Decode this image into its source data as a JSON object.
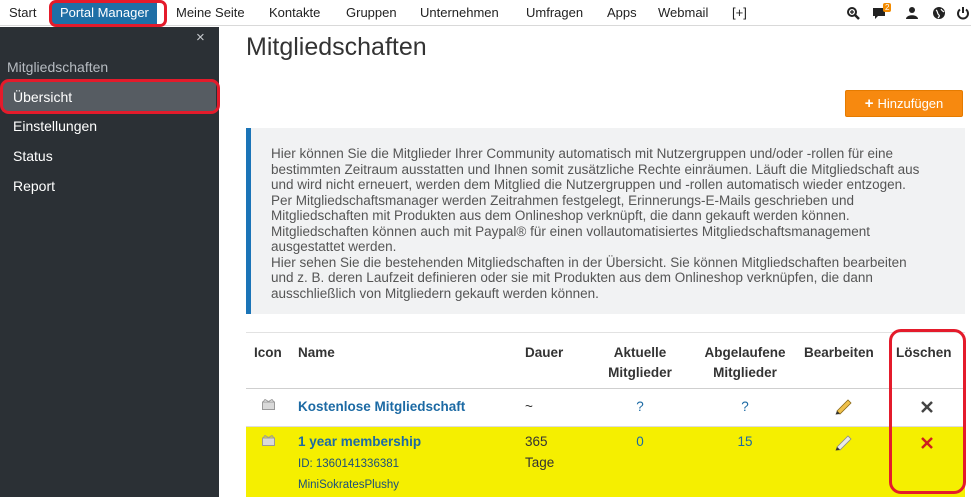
{
  "topnav": {
    "items": [
      "Start",
      "Portal Manager",
      "Meine Seite",
      "Kontakte",
      "Gruppen",
      "Unternehmen",
      "Umfragen",
      "Apps",
      "Webmail",
      "[+]"
    ],
    "active": "Portal Manager",
    "notification_count": "2",
    "icons": [
      "search-icon",
      "chat-icon",
      "user-icon",
      "globe-icon",
      "power-icon"
    ]
  },
  "sidebar": {
    "close": "×",
    "heading": "Mitgliedschaften",
    "items": [
      "Übersicht",
      "Einstellungen",
      "Status",
      "Report"
    ],
    "selected": "Übersicht"
  },
  "main": {
    "title": "Mitgliedschaften",
    "add_button": "Hinzufügen",
    "info_lines": [
      "Hier können Sie die Mitglieder Ihrer Community automatisch mit Nutzergruppen und/oder -rollen für eine",
      "bestimmten Zeitraum ausstatten und Ihnen somit zusätzliche Rechte einräumen. Läuft die Mitgliedschaft aus",
      "und wird nicht erneuert, werden dem Mitglied die Nutzergruppen und -rollen automatisch wieder entzogen.",
      "Per Mitgliedschaftsmanager werden Zeitrahmen festgelegt, Erinnerungs-E-Mails geschrieben und",
      "Mitgliedschaften mit Produkten aus dem Onlineshop verknüpft, die dann gekauft werden können.",
      "Mitgliedschaften können auch mit Paypal® für einen vollautomatisiertes Mitgliedschaftsmanagement",
      "ausgestattet werden.",
      "Hier sehen Sie die bestehenden Mitgliedschaften in der Übersicht. Sie können Mitgliedschaften bearbeiten",
      "und z. B. deren Laufzeit definieren oder sie mit Produkten aus dem Onlineshop verknüpfen, die dann",
      "ausschließlich von Mitgliedern gekauft werden können."
    ]
  },
  "table": {
    "headers": {
      "icon": "Icon",
      "name": "Name",
      "duration": "Dauer",
      "current_1": "Aktuelle",
      "current_2": "Mitglieder",
      "expired_1": "Abgelaufene",
      "expired_2": "Mitglieder",
      "edit": "Bearbeiten",
      "delete": "Löschen"
    },
    "rows": [
      {
        "name": "Kostenlose Mitgliedschaft",
        "duration": "~",
        "current": "?",
        "expired": "?",
        "highlighted": false
      },
      {
        "name": "1 year membership",
        "id_line": "ID: 1360141336381",
        "product": "MiniSokratesPlushy",
        "duration_1": "365",
        "duration_2": "Tage",
        "current": "0",
        "expired": "15",
        "highlighted": true
      }
    ]
  },
  "colors": {
    "nav_active": "#1f6fa6",
    "annotation": "#e41b2b",
    "sidebar_bg": "#2b3035",
    "accent_orange": "#f7890f",
    "highlight_row": "#f5ef00",
    "link": "#1c6aa4"
  }
}
